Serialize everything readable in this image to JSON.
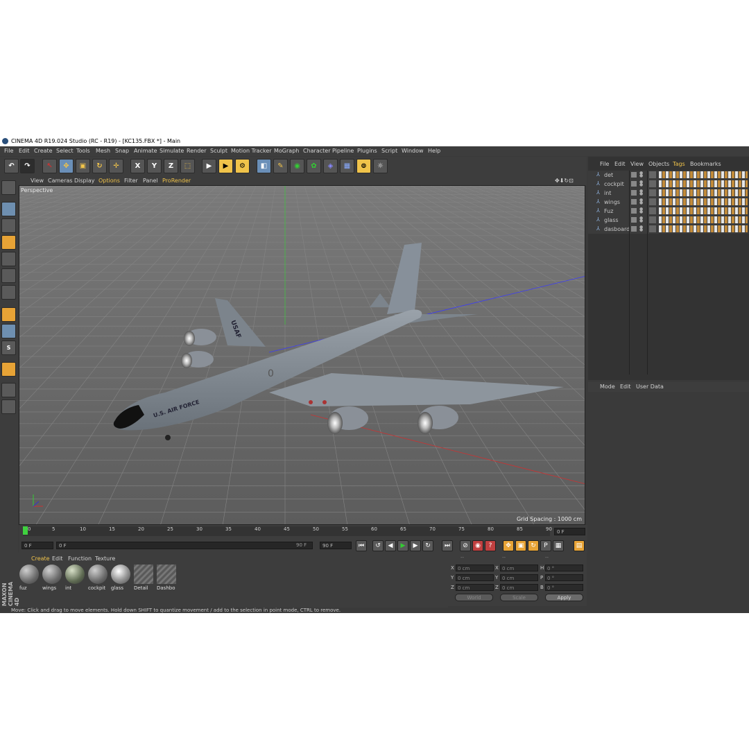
{
  "window": {
    "title": "CINEMA 4D R19.024 Studio (RC - R19) - [KC135.FBX *] - Main"
  },
  "menubar": [
    "File",
    "Edit",
    "Create",
    "Select",
    "Tools",
    "Mesh",
    "Snap",
    "Animate",
    "Simulate",
    "Render",
    "Sculpt",
    "Motion Tracker",
    "MoGraph",
    "Character",
    "Pipeline",
    "Plugins",
    "Script",
    "Window",
    "Help"
  ],
  "toolbar": {
    "axis_x": "X",
    "axis_y": "Y",
    "axis_z": "Z"
  },
  "viewport": {
    "menu": [
      "View",
      "Cameras",
      "Display",
      "Options",
      "Filter",
      "Panel",
      "ProRender"
    ],
    "label": "Perspective",
    "grid_spacing": "Grid Spacing : 1000 cm",
    "aircraft": {
      "fuselage_text": "U.S. AIR FORCE",
      "tail_text": "USAF",
      "number": "0"
    }
  },
  "timeline": {
    "ticks": [
      "0",
      "5",
      "10",
      "15",
      "20",
      "25",
      "30",
      "35",
      "40",
      "45",
      "50",
      "55",
      "60",
      "65",
      "70",
      "75",
      "80",
      "85",
      "90"
    ],
    "end_field": "0 F"
  },
  "transport": {
    "current_frame": "0 F",
    "range_start": "0 F",
    "range_end": "90 F",
    "max_frame": "90 F",
    "p_label": "P"
  },
  "materials": {
    "menu": [
      "Create",
      "Edit",
      "Function",
      "Texture"
    ],
    "items": [
      "fuz",
      "wings",
      "int",
      "cockpit",
      "glass",
      "Detail",
      "Dashbo"
    ]
  },
  "brand": "MAXON CINEMA 4D",
  "coordinates": {
    "headers": [
      "--",
      "--",
      "--"
    ],
    "rows": [
      {
        "a": "X",
        "av": "0 cm",
        "b": "X",
        "bv": "0 cm",
        "c": "H",
        "cv": "0 °"
      },
      {
        "a": "Y",
        "av": "0 cm",
        "b": "Y",
        "bv": "0 cm",
        "c": "P",
        "cv": "0 °"
      },
      {
        "a": "Z",
        "av": "0 cm",
        "b": "Z",
        "bv": "0 cm",
        "c": "B",
        "cv": "0 °"
      }
    ],
    "world": "World",
    "scale": "Scale",
    "apply": "Apply"
  },
  "status": "Move: Click and drag to move elements. Hold down SHIFT to quantize movement / add to the selection in point mode, CTRL to remove.",
  "objects": {
    "menu": [
      "File",
      "Edit",
      "View",
      "Objects",
      "Tags",
      "Bookmarks"
    ],
    "items": [
      "det",
      "cockpit",
      "int",
      "wings",
      "Fuz",
      "glass",
      "dasboard"
    ]
  },
  "attributes": {
    "menu": [
      "Mode",
      "Edit",
      "User Data"
    ]
  }
}
